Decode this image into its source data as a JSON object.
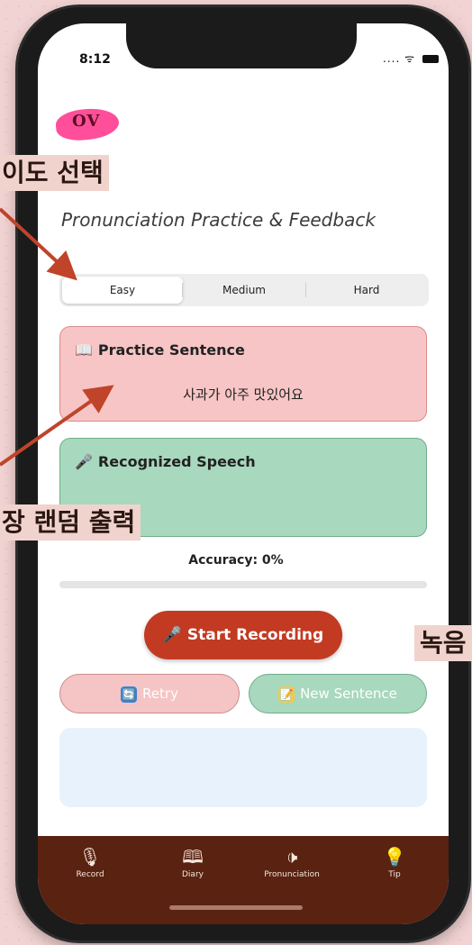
{
  "status_bar": {
    "time": "8:12",
    "signal": "....",
    "wifi": "ᯤ"
  },
  "logo": {
    "text": "OV"
  },
  "callouts": {
    "difficulty": "이도 선택",
    "random_sentence": "장 랜덤 출력",
    "recording": "녹음"
  },
  "subtitle": "Pronunciation Practice & Feedback",
  "difficulty": {
    "options": [
      "Easy",
      "Medium",
      "Hard"
    ],
    "selected": "Easy"
  },
  "practice": {
    "title": "Practice Sentence",
    "icon": "📖",
    "sentence": "사과가 아주 맛있어요"
  },
  "speech": {
    "title": "Recognized Speech",
    "icon": "🎤",
    "text": ""
  },
  "accuracy": {
    "label": "Accuracy: 0%",
    "value": 0
  },
  "buttons": {
    "record": "Start Recording",
    "record_icon": "🎤",
    "retry": "Retry",
    "retry_icon": "🔄",
    "new_sentence": "New Sentence",
    "new_sentence_icon": "📝"
  },
  "tabs": [
    {
      "label": "Record",
      "icon": "🎙"
    },
    {
      "label": "Diary",
      "icon": "🕮"
    },
    {
      "label": "Pronunciation",
      "icon": "🕩"
    },
    {
      "label": "Tip",
      "icon": "💡"
    }
  ],
  "colors": {
    "accent": "#c23a22",
    "practice_card": "#f7c5c5",
    "speech_card": "#a8d8bd",
    "tabbar": "#5a2210",
    "arrow": "#c0442a"
  }
}
